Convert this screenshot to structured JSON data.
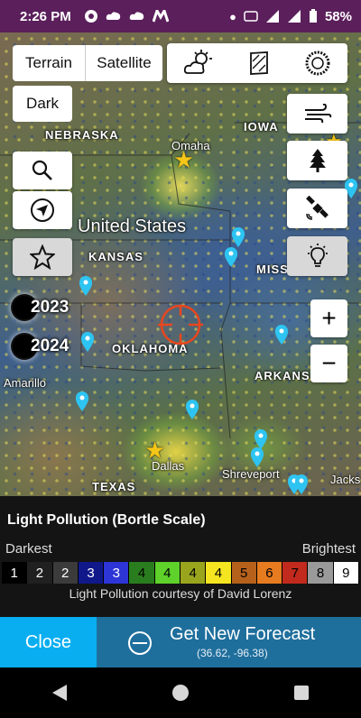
{
  "status_bar": {
    "time": "2:26 PM",
    "battery": "58%",
    "icons": [
      "chrome-icon",
      "cloud-icon",
      "cloud-icon",
      "app-m-icon",
      "dot-icon",
      "volte-icon",
      "signal-icon",
      "signal-icon",
      "battery-icon"
    ]
  },
  "map": {
    "layer_buttons": [
      "Terrain",
      "Satellite",
      "Dark"
    ],
    "labels": {
      "country": "United States",
      "nebraska": "NEBRASKA",
      "iowa": "IOWA",
      "kansas": "KANSAS",
      "missouri": "MISS",
      "oklahoma": "OKLAHOMA",
      "arkansas": "ARKANS",
      "texas": "TEXAS",
      "omaha": "Omaha",
      "amarillo": "Amarillo",
      "dallas": "Dallas",
      "shreveport": "Shreveport",
      "jackson": "Jacks"
    },
    "eclipse_years": [
      "2023",
      "2024"
    ],
    "zoom_in": "+",
    "zoom_out": "−"
  },
  "legend": {
    "title": "Light Pollution (Bortle Scale)",
    "darkest": "Darkest",
    "brightest": "Brightest",
    "scale": [
      {
        "label": "1",
        "color": "#000000",
        "text": "#ffffff"
      },
      {
        "label": "2",
        "color": "#202020",
        "text": "#ffffff"
      },
      {
        "label": "2",
        "color": "#3b3b3b",
        "text": "#ffffff"
      },
      {
        "label": "3",
        "color": "#10188a",
        "text": "#ffffff"
      },
      {
        "label": "3",
        "color": "#2d35d6",
        "text": "#ffffff"
      },
      {
        "label": "4",
        "color": "#2a7d1e",
        "text": "#000000"
      },
      {
        "label": "4",
        "color": "#5ed12b",
        "text": "#000000"
      },
      {
        "label": "4",
        "color": "#9aa51e",
        "text": "#000000"
      },
      {
        "label": "4",
        "color": "#f4e520",
        "text": "#000000"
      },
      {
        "label": "5",
        "color": "#b5611c",
        "text": "#000000"
      },
      {
        "label": "6",
        "color": "#e77b1f",
        "text": "#000000"
      },
      {
        "label": "7",
        "color": "#c22a1d",
        "text": "#000000"
      },
      {
        "label": "8",
        "color": "#9a9a9a",
        "text": "#000000"
      },
      {
        "label": "9",
        "color": "#ffffff",
        "text": "#000000"
      }
    ],
    "credit": "Light Pollution courtesy of David Lorenz"
  },
  "actions": {
    "close": "Close",
    "forecast_label": "Get New Forecast",
    "forecast_coords": "(36.62, -96.38)"
  },
  "colors": {
    "status_bar": "#5b1f5b",
    "close_button": "#08aef0",
    "forecast_bar": "#1f6f9d",
    "star": "#f5c518",
    "pin": "#2ec4f2",
    "target": "#e8461e"
  }
}
